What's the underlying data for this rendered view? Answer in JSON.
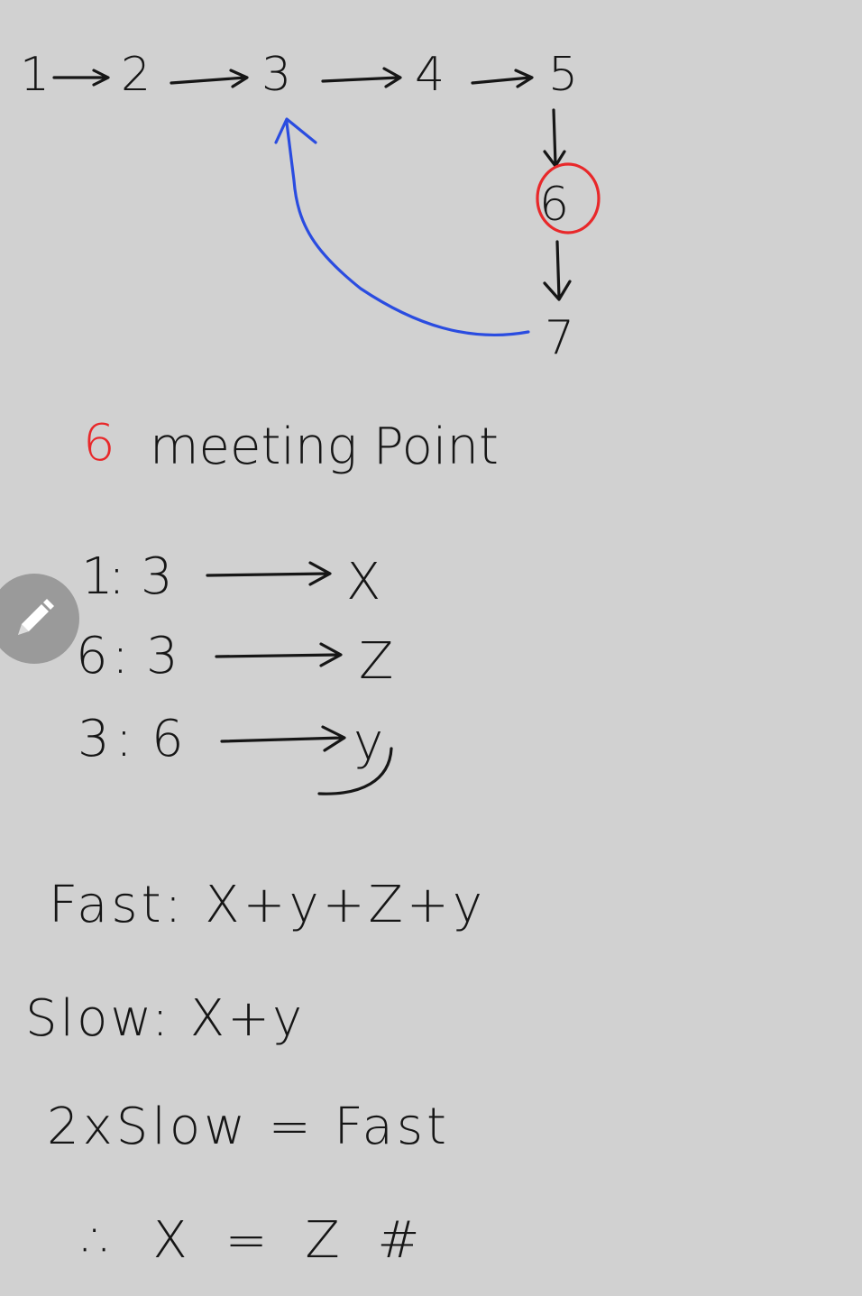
{
  "canvas": {
    "background": "#d1d1d1",
    "ink_color": "#161616"
  },
  "list": {
    "nodes": [
      "1",
      "2",
      "3",
      "4",
      "5",
      "6",
      "7"
    ],
    "highlighted_node": "6",
    "highlight_color": "#e8282a",
    "cycle_link_color": "#2a4ce0"
  },
  "meeting": {
    "number": "6",
    "label": "meeting Point"
  },
  "segments": [
    {
      "from": "1",
      "sep": ":",
      "to": "3",
      "name": "X"
    },
    {
      "from": "6",
      "sep": ":",
      "to": "3",
      "name": "Z"
    },
    {
      "from": "3",
      "sep": ":",
      "to": "6",
      "name": "y"
    }
  ],
  "equations": {
    "fast": "Fast: X+y+Z+y",
    "slow": "Slow: X+y",
    "relation": "2xSlow = Fast",
    "conclusion": "∴ X = Z #"
  },
  "tool": {
    "icon": "pencil-icon"
  }
}
